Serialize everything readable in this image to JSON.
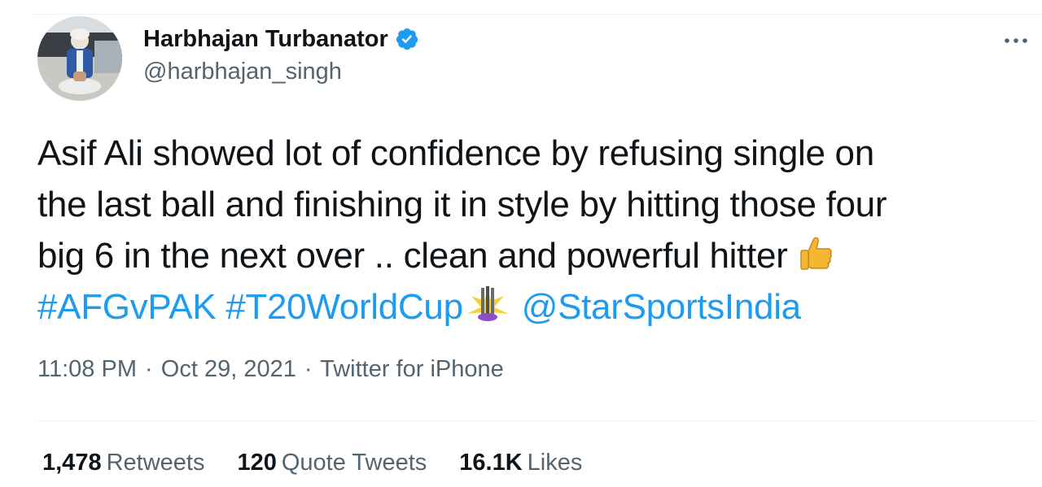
{
  "author": {
    "display_name": "Harbhajan Turbanator",
    "handle": "@harbhajan_singh",
    "verified": true,
    "verified_icon": "verified-badge-icon",
    "verified_color": "#1d9bf0"
  },
  "tweet": {
    "line1": "Asif Ali showed lot of confidence by refusing single on",
    "line2": "the last ball and finishing it in style by hitting those four",
    "line3": "big 6 in the next over .. clean and powerful hitter",
    "emoji_thumbs": "thumbs-up-icon",
    "hashtag1": "#AFGvPAK",
    "hashtag2": "#T20WorldCup",
    "emoji_trophy": "t20-world-cup-icon",
    "mention": "@StarSportsIndia",
    "link_color": "#1d9bf0"
  },
  "meta": {
    "time": "11:08 PM",
    "separator": "·",
    "date": "Oct 29, 2021",
    "source": "Twitter for iPhone"
  },
  "stats": {
    "retweets_count": "1,478",
    "retweets_label": "Retweets",
    "quotes_count": "120",
    "quotes_label": "Quote Tweets",
    "likes_count": "16.1K",
    "likes_label": "Likes"
  },
  "more_icon": "more-horizontal-icon"
}
